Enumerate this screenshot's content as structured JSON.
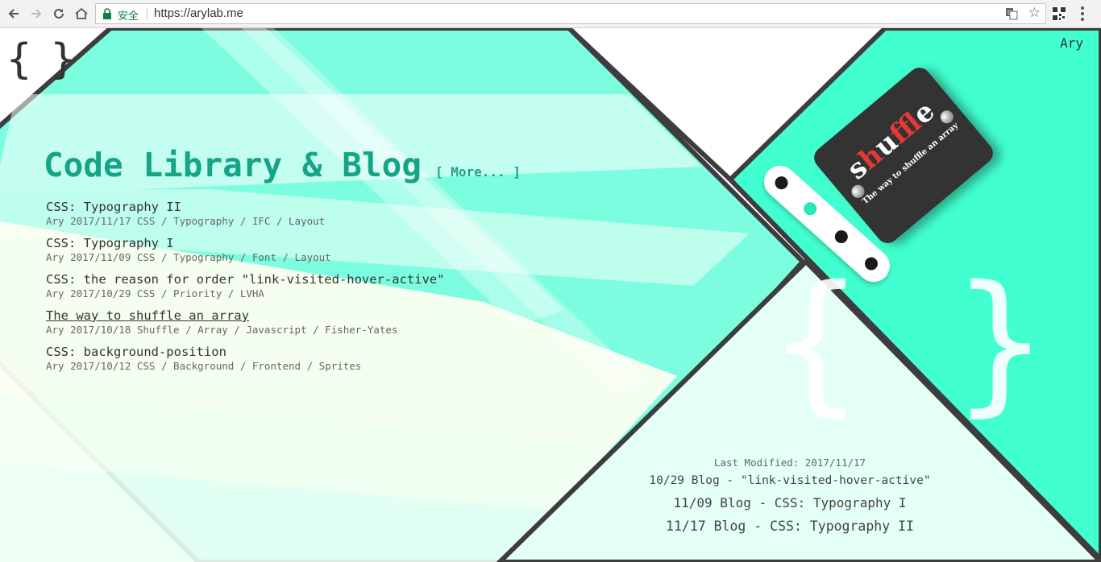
{
  "browser": {
    "secure_label": "安全",
    "url": "https://arylab.me"
  },
  "site": {
    "logo": "{ }",
    "author": "Ary",
    "heading": "Code Library & Blog",
    "more_link": "[ More... ]",
    "watermark": "{ }"
  },
  "posts": [
    {
      "title": "CSS: Typography II",
      "meta": "Ary 2017/11/17 CSS / Typography / IFC / Layout"
    },
    {
      "title": "CSS: Typography I",
      "meta": "Ary 2017/11/09 CSS / Typography / Font / Layout"
    },
    {
      "title": "CSS: the reason for order \"link-visited-hover-active\"",
      "meta": "Ary 2017/10/29 CSS / Priority / LVHA"
    },
    {
      "title": "The way to shuffle an array",
      "meta": "Ary 2017/10/18 Shuffle / Array / Javascript / Fisher-Yates"
    },
    {
      "title": "CSS: background-position",
      "meta": "Ary 2017/10/12 CSS / Background / Frontend / Sprites"
    }
  ],
  "changelog": {
    "modified": "Last Modified: 2017/11/17",
    "entries": [
      "10/29 Blog - \"link-visited-hover-active\"",
      "11/09 Blog - CSS: Typography I",
      "11/17 Blog - CSS: Typography II"
    ]
  },
  "feature_card": {
    "title_pre": "s",
    "title_hl": "h",
    "title_mid": "u",
    "title_hl2": "f",
    "title_post": "fle",
    "subtitle": "The way to shuffle an array"
  },
  "colors": {
    "accent": "#16a486",
    "mint": "#41ffcf",
    "border": "#3a3a3a"
  }
}
